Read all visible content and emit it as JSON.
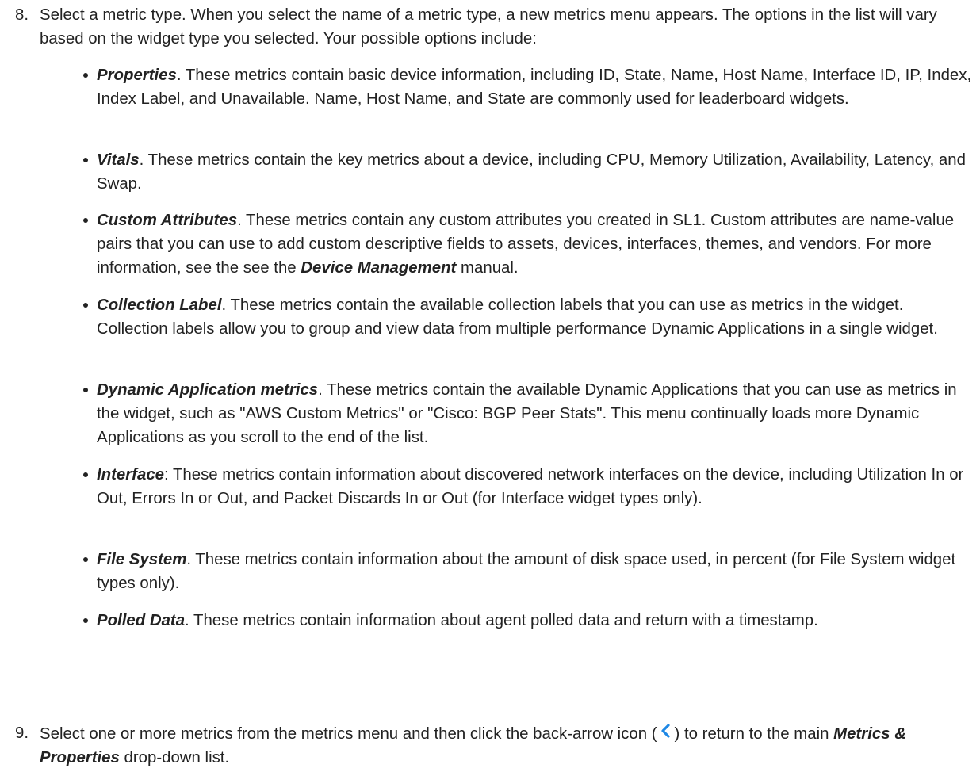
{
  "step8": {
    "number": "8.",
    "text": "Select a metric type. When you select the name of a metric type, a new metrics menu appears. The options in the list will vary based on the widget type you selected. Your possible options include:"
  },
  "bullets": [
    {
      "term": "Properties",
      "body": ". These metrics contain basic device information, including ID, State, Name, Host Name, Interface ID, IP, Index, Index Label, and Unavailable. Name, Host Name, and State are commonly used for leaderboard widgets."
    },
    {
      "term": "Vitals",
      "body": ". These metrics contain the key metrics about a device, including CPU, Memory Utilization, Availability, Latency, and Swap."
    },
    {
      "term": "Custom Attributes",
      "body_before": ". These metrics contain any custom attributes you created in SL1. Custom attributes are name-value pairs that you can use to add custom descriptive fields to assets, devices, interfaces, themes, and vendors. For more information, see the see the ",
      "emphasis": "Device Management",
      "body_after": " manual."
    },
    {
      "term": "Collection Label",
      "body": ". These metrics contain the available collection labels that you can use as metrics in the widget. Collection labels allow you to group and view data from multiple performance Dynamic Applications in a single widget."
    },
    {
      "term": "Dynamic Application metrics",
      "body": ". These metrics contain the available Dynamic Applications that you can use as metrics in the widget, such as \"AWS Custom Metrics\" or \"Cisco: BGP Peer Stats\". This menu continually loads more Dynamic Applications as you scroll to the end of the list."
    },
    {
      "term": "Interface",
      "body": ": These metrics contain information about discovered network interfaces on the device, including Utilization In or Out, Errors In or Out, and Packet Discards In or Out (for Interface widget types only)."
    },
    {
      "term": "File System",
      "body": ". These metrics contain information about the amount of disk space used, in percent (for File System widget types only)."
    },
    {
      "term": "Polled Data",
      "body": ". These metrics contain information about agent polled data and return with a timestamp."
    }
  ],
  "step9": {
    "number": "9.",
    "text_before": "Select one or more metrics from the metrics menu and then click the back-arrow icon (",
    "icon": "back-arrow-icon",
    "text_middle": ") to return to the main ",
    "emphasis": "Metrics & Properties",
    "text_after": " drop-down list."
  },
  "colors": {
    "text": "#222222",
    "icon_accent": "#1e88e5"
  }
}
